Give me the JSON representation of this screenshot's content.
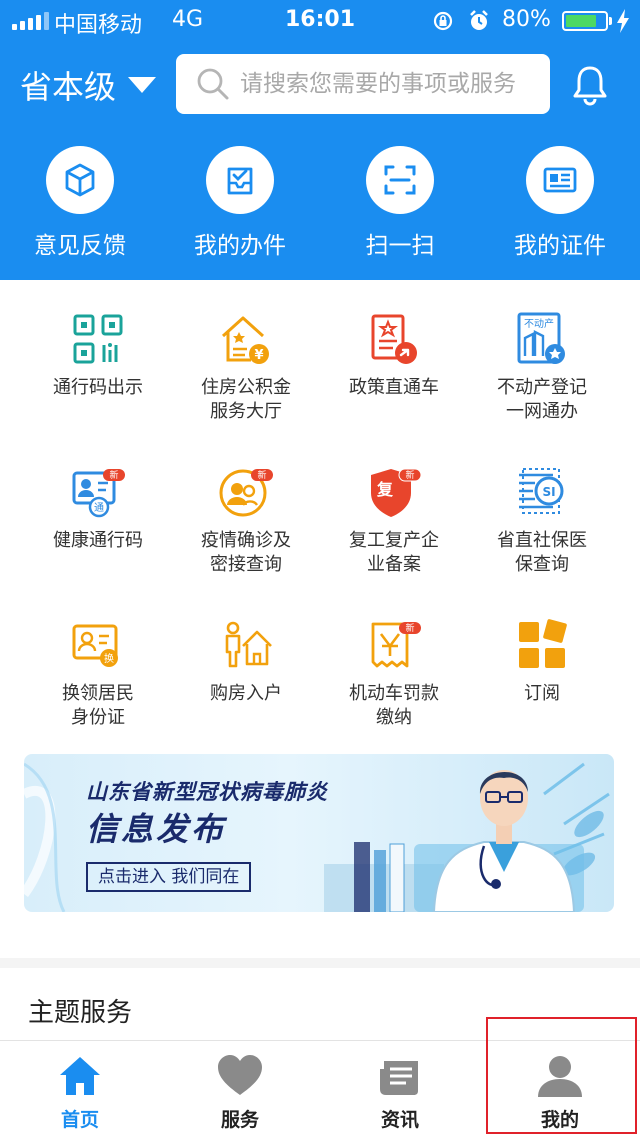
{
  "status_bar": {
    "carrier": "中国移动",
    "network": "4G",
    "time": "16:01",
    "battery_percent": "80%",
    "battery_level": 0.8,
    "battery_color": "#4cd964"
  },
  "header": {
    "region": "省本级",
    "search_placeholder": "请搜索您需要的事项或服务",
    "bg_color": "#1a8df0"
  },
  "quick_actions": [
    {
      "label": "意见反馈",
      "icon": "cube-icon"
    },
    {
      "label": "我的办件",
      "icon": "inbox-check-icon"
    },
    {
      "label": "扫一扫",
      "icon": "scan-icon"
    },
    {
      "label": "我的证件",
      "icon": "id-card-icon"
    }
  ],
  "services": [
    {
      "label": "通行码出示",
      "icon": "qr-code-icon"
    },
    {
      "label": "住房公积金\n服务大厅",
      "icon": "house-fund-icon"
    },
    {
      "label": "政策直通车",
      "icon": "policy-document-icon"
    },
    {
      "label": "不动产登记\n一网通办",
      "icon": "real-estate-icon",
      "icon_text": "不动产"
    },
    {
      "label": "健康通行码",
      "icon": "health-pass-icon",
      "badge": "新",
      "icon_text": "通"
    },
    {
      "label": "疫情确诊及\n密接查询",
      "icon": "epidemic-query-icon",
      "badge": "新"
    },
    {
      "label": "复工复产企\n业备案",
      "icon": "resume-work-shield-icon",
      "badge": "新",
      "icon_text": "复"
    },
    {
      "label": "省直社保医\n保查询",
      "icon": "social-security-icon",
      "icon_text": "SI"
    },
    {
      "label": "换领居民\n身份证",
      "icon": "id-renewal-icon",
      "icon_text": "换"
    },
    {
      "label": "购房入户",
      "icon": "home-purchase-icon"
    },
    {
      "label": "机动车罚款\n缴纳",
      "icon": "vehicle-fine-icon",
      "badge": "新"
    },
    {
      "label": "订阅",
      "icon": "subscribe-grid-icon"
    }
  ],
  "banner": {
    "title_line1": "山东省新型冠状病毒肺炎",
    "title_line2": "信息发布",
    "cta": "点击进入 我们同在"
  },
  "theme_section": {
    "title": "主题服务"
  },
  "tabbar": [
    {
      "label": "首页",
      "icon": "home-icon",
      "active": true
    },
    {
      "label": "服务",
      "icon": "heart-icon",
      "active": false
    },
    {
      "label": "资讯",
      "icon": "news-icon",
      "active": false
    },
    {
      "label": "我的",
      "icon": "user-icon",
      "active": false
    }
  ],
  "colors": {
    "primary": "#1a8df0",
    "icon_teal": "#1aa39a",
    "icon_orange": "#f2a10d",
    "icon_red": "#e8452c",
    "icon_blue": "#2f8be0",
    "highlight": "#e0212a"
  }
}
